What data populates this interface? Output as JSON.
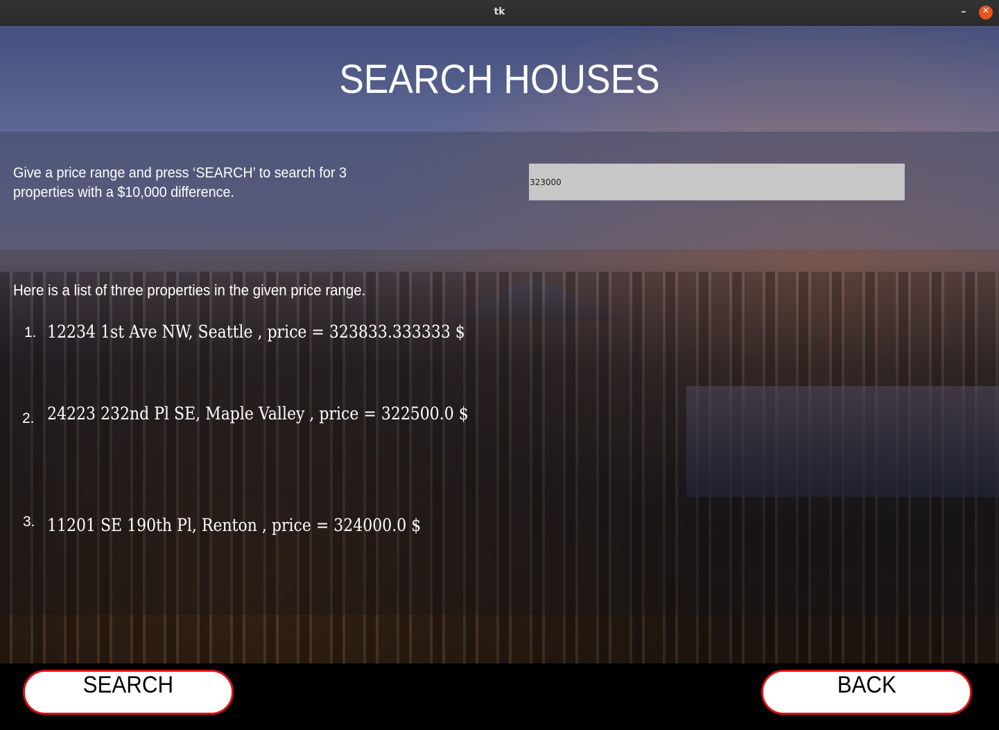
{
  "window": {
    "title": "tk",
    "minimize_glyph": "–",
    "close_glyph": "✕"
  },
  "colors": {
    "accent_red": "#e01010",
    "input_bg": "#c7c7c7",
    "close_button": "#e95420"
  },
  "header": {
    "title": "SEARCH HOUSES"
  },
  "search": {
    "instruction_line1": "Give a price range and press ‘SEARCH’ to search for 3",
    "instruction_line2": "properties with a $10,000 difference.",
    "value": "323000"
  },
  "results": {
    "intro": "Here is a list of three properties in the given price range.",
    "items": [
      {
        "num": "1.",
        "text": "12234 1st Ave NW, Seattle , price = 323833.333333 $"
      },
      {
        "num": "2.",
        "text": "24223 232nd Pl SE, Maple Valley , price = 322500.0 $"
      },
      {
        "num": "3.",
        "text": "11201 SE 190th Pl, Renton , price = 324000.0 $"
      }
    ]
  },
  "footer": {
    "search_label": "SEARCH",
    "back_label": "BACK"
  }
}
